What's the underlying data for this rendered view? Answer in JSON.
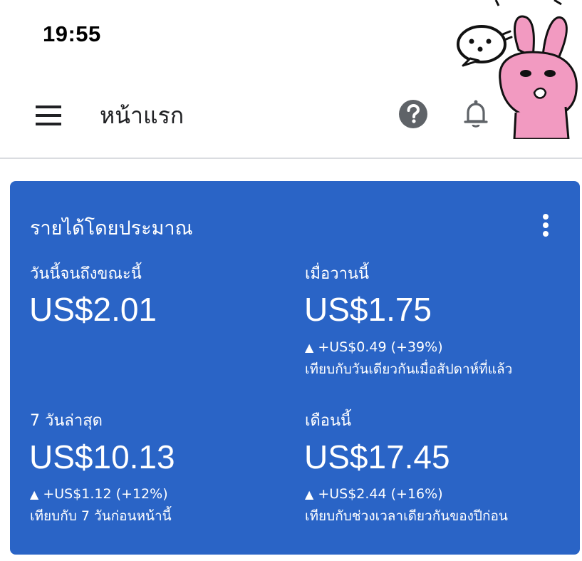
{
  "status_bar": {
    "time": "19:55"
  },
  "app_bar": {
    "title": "หน้าแรก",
    "menu_icon": "hamburger-menu-icon",
    "help_icon": "help-circle-icon",
    "notifications_icon": "bell-icon"
  },
  "card": {
    "title": "รายได้โดยประมาณ",
    "more_icon": "more-vert-icon",
    "color": "#2a64c6",
    "metrics": [
      {
        "label": "วันนี้จนถึงขณะนี้",
        "value": "US$2.01"
      },
      {
        "label": "เมื่อวานนี้",
        "value": "US$1.75",
        "change": "+US$0.49 (+39%)",
        "comparison": "เทียบกับวันเดียวกันเมื่อสัปดาห์ที่แล้ว"
      },
      {
        "label": "7 วันล่าสุด",
        "value": "US$10.13",
        "change": "+US$1.12 (+12%)",
        "comparison": "เทียบกับ 7 วันก่อนหน้านี้"
      },
      {
        "label": "เดือนนี้",
        "value": "US$17.45",
        "change": "+US$2.44 (+16%)",
        "comparison": "เทียบกับช่วงเวลาเดียวกันของปีก่อน"
      }
    ]
  }
}
